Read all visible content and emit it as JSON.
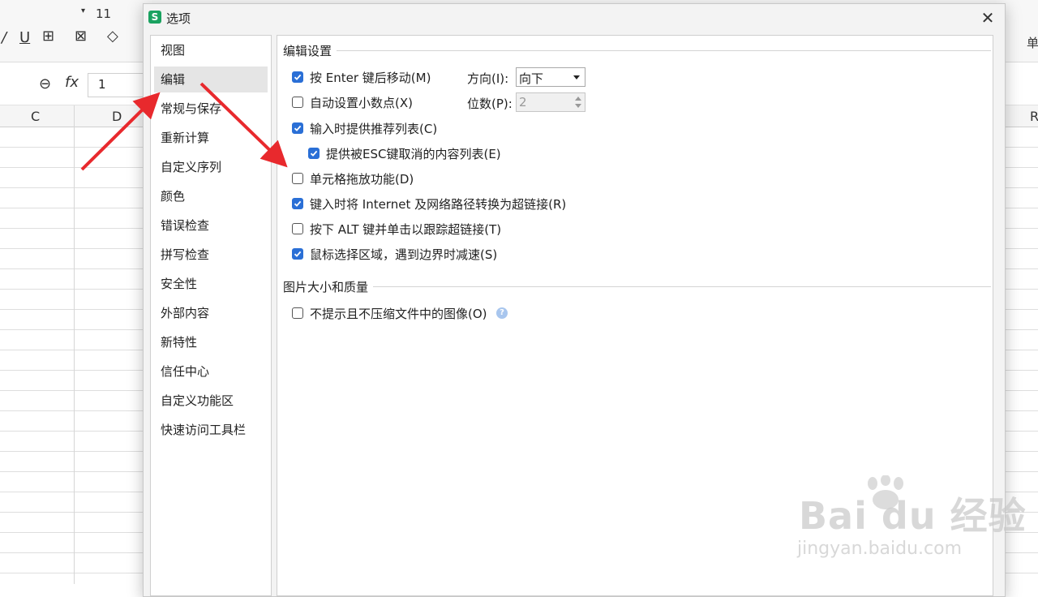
{
  "spreadsheet": {
    "font_size": "11",
    "name_box_value": "1",
    "fx_label": "fx",
    "columns": [
      "C",
      "D",
      "R"
    ],
    "right_toolbar_text": "单"
  },
  "dialog": {
    "title": "选项",
    "close_icon": "close-icon",
    "nav": [
      {
        "label": "视图",
        "selected": false
      },
      {
        "label": "编辑",
        "selected": true
      },
      {
        "label": "常规与保存",
        "selected": false
      },
      {
        "label": "重新计算",
        "selected": false
      },
      {
        "label": "自定义序列",
        "selected": false
      },
      {
        "label": "颜色",
        "selected": false
      },
      {
        "label": "错误检查",
        "selected": false
      },
      {
        "label": "拼写检查",
        "selected": false
      },
      {
        "label": "安全性",
        "selected": false
      },
      {
        "label": "外部内容",
        "selected": false
      },
      {
        "label": "新特性",
        "selected": false
      },
      {
        "label": "信任中心",
        "selected": false
      },
      {
        "label": "自定义功能区",
        "selected": false
      },
      {
        "label": "快速访问工具栏",
        "selected": false
      }
    ],
    "edit_settings": {
      "section_title": "编辑设置",
      "options": [
        {
          "label": "按 Enter 键后移动(M)",
          "checked": true
        },
        {
          "label": "自动设置小数点(X)",
          "checked": false
        },
        {
          "label": "输入时提供推荐列表(C)",
          "checked": true
        },
        {
          "label": "提供被ESC键取消的内容列表(E)",
          "checked": true
        },
        {
          "label": "单元格拖放功能(D)",
          "checked": false
        },
        {
          "label": "键入时将 Internet 及网络路径转换为超链接(R)",
          "checked": true
        },
        {
          "label": "按下 ALT 键并单击以跟踪超链接(T)",
          "checked": false
        },
        {
          "label": "鼠标选择区域，遇到边界时减速(S)",
          "checked": true
        }
      ],
      "direction_label": "方向(I):",
      "direction_value": "向下",
      "digits_label": "位数(P):",
      "digits_value": "2"
    },
    "image_quality": {
      "section_title": "图片大小和质量",
      "options": [
        {
          "label": "不提示且不压缩文件中的图像(O)",
          "checked": false
        }
      ],
      "help_icon": "help-icon"
    }
  },
  "watermark": {
    "brand": "Bai du 经验",
    "url": "jingyan.baidu.com"
  },
  "colors": {
    "accent": "#2a6fd6",
    "arrow": "#e8292d",
    "app_icon": "#1aa260"
  }
}
